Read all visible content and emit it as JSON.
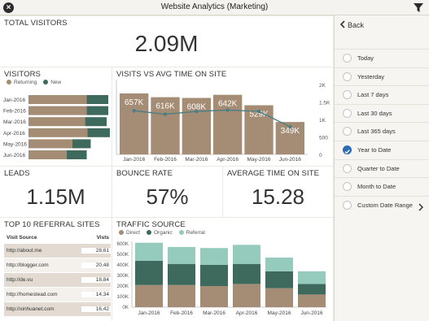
{
  "app": {
    "title": "Website Analytics (Marketing)"
  },
  "total_visitors": {
    "title": "TOTAL VISITORS",
    "value": "2.09M"
  },
  "visitors": {
    "title": "VISITORS",
    "legend": [
      "Returning",
      "New"
    ],
    "months": [
      "Jan-2016",
      "Feb-2016",
      "Mar-2016",
      "Apr-2016",
      "May-2016",
      "Jun-2016"
    ],
    "returning": [
      0.73,
      0.73,
      0.71,
      0.74,
      0.55,
      0.48
    ],
    "new": [
      0.27,
      0.27,
      0.27,
      0.28,
      0.23,
      0.25
    ]
  },
  "visits_time": {
    "title": "VISITS VS AVG TIME ON SITE",
    "y_right_ticks": [
      "2K",
      "1.5K",
      "1K",
      "500",
      "0"
    ]
  },
  "leads": {
    "title": "LEADS",
    "value": "1.15M"
  },
  "bounce_rate": {
    "title": "BOUNCE RATE",
    "value": "57%"
  },
  "avg_time": {
    "title": "AVERAGE TIME ON SITE",
    "value": "15.28"
  },
  "referral": {
    "title": "TOP 10 REFERRAL SITES",
    "headers": [
      "Visit Source",
      "Vists"
    ],
    "rows": [
      {
        "source": "http://about.me",
        "visits": "28,61"
      },
      {
        "source": "http://blogger.com",
        "visits": "20,48"
      },
      {
        "source": "http://de.vu",
        "visits": "18,84"
      },
      {
        "source": "http://homestead.com",
        "visits": "14,34"
      },
      {
        "source": "http://xinhuanet.com",
        "visits": "16,42"
      }
    ]
  },
  "traffic": {
    "title": "TRAFFIC SOURCE",
    "legend": [
      "Direct",
      "Organic",
      "Referral"
    ]
  },
  "sidebar": {
    "back": "Back",
    "items": [
      {
        "label": "Today",
        "selected": false
      },
      {
        "label": "Yesterday",
        "selected": false
      },
      {
        "label": "Last 7 days",
        "selected": false
      },
      {
        "label": "Last 30 days",
        "selected": false
      },
      {
        "label": "Last 365 days",
        "selected": false
      },
      {
        "label": "Year to Date",
        "selected": true
      },
      {
        "label": "Quarter to Date",
        "selected": false
      },
      {
        "label": "Month to Date",
        "selected": false
      },
      {
        "label": "Custom Date Range",
        "selected": false
      }
    ]
  },
  "colors": {
    "brown": "#a58c74",
    "darkgreen": "#3e6a5e",
    "teal": "#94cbbd",
    "accent": "#2b6cb7"
  },
  "chart_data": [
    {
      "type": "bar",
      "title": "VISITS VS AVG TIME ON SITE",
      "categories": [
        "Jan-2016",
        "Feb-2016",
        "Mar-2016",
        "Apr-2016",
        "May-2016",
        "Jun-2016"
      ],
      "series": [
        {
          "values": [
            657,
            616,
            608,
            642,
            529,
            349
          ],
          "labels": [
            "657K",
            "616K",
            "608K",
            "642K",
            "529K",
            "349K"
          ]
        },
        {
          "values": [
            1250,
            1150,
            1230,
            1270,
            1230,
            790
          ]
        }
      ],
      "y_right_ticks": [
        "2K",
        "1.5K",
        "1K",
        "500",
        "0"
      ],
      "ylim_right": [
        0,
        2000
      ]
    },
    {
      "type": "bar",
      "title": "TRAFFIC SOURCE",
      "categories": [
        "Jan-2016",
        "Feb-2016",
        "Mar-2016",
        "Apr-2016",
        "May-2016",
        "Jun-2016"
      ],
      "y_ticks": [
        "600K",
        "500K",
        "400K",
        "300K",
        "200K",
        "100K",
        "0K"
      ],
      "ylim": [
        0,
        600
      ],
      "series": [
        {
          "name": "Direct",
          "values": [
            210,
            210,
            200,
            220,
            180,
            120
          ]
        },
        {
          "name": "Organic",
          "values": [
            230,
            200,
            200,
            190,
            160,
            100
          ]
        },
        {
          "name": "Referral",
          "values": [
            170,
            160,
            160,
            180,
            130,
            120
          ]
        }
      ]
    }
  ]
}
